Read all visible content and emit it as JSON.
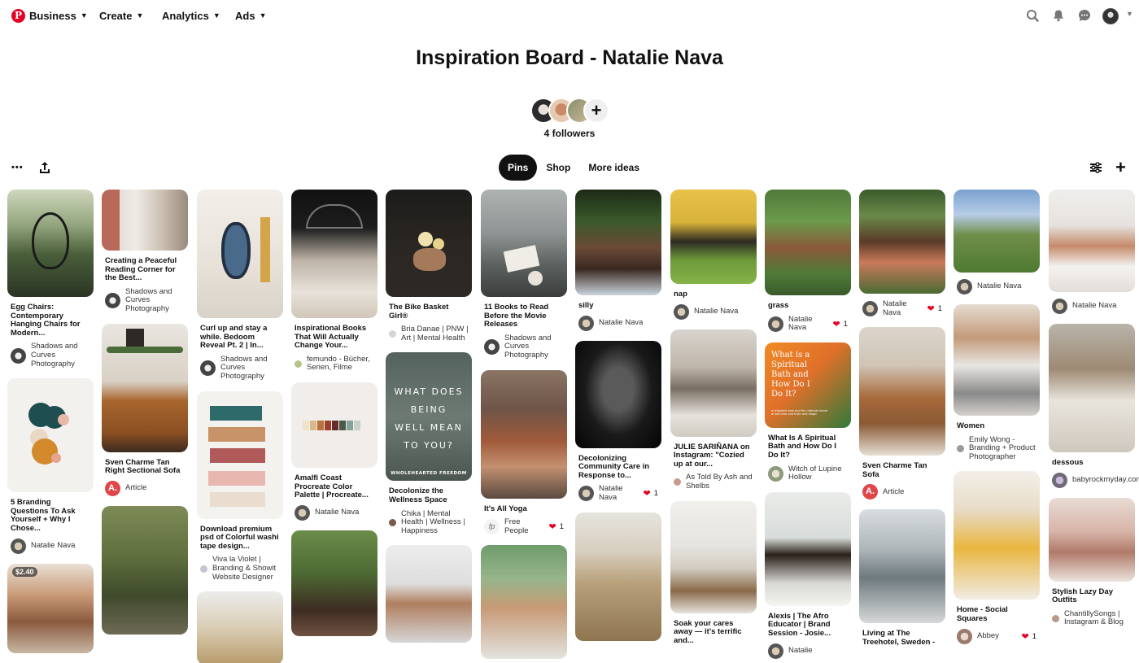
{
  "nav": {
    "logo": "P",
    "business": "Business",
    "create": "Create",
    "analytics": "Analytics",
    "ads": "Ads",
    "chevron": "⌄"
  },
  "icons": {
    "search": "search-icon",
    "bell": "bell-icon",
    "messages": "messages-icon",
    "avatar": "avatar",
    "chevron": "chevron-down-icon"
  },
  "board": {
    "title": "Inspiration Board - Natalie Nava",
    "followers": "4 followers",
    "add_collaborator": "+"
  },
  "toolbar": {
    "more": "•••",
    "share": "⇪",
    "filter": "⇋",
    "add": "+"
  },
  "tabs": [
    {
      "label": "Pins",
      "active": true
    },
    {
      "label": "Shop",
      "active": false
    },
    {
      "label": "More ideas",
      "active": false
    }
  ],
  "pins": {
    "c1": [
      {
        "title": "Egg Chairs: Contemporary Hanging Chairs for Modern...",
        "author": "Shadows and Curves Photography"
      },
      {
        "title": "5 Branding Questions To Ask Yourself + Why I Chose...",
        "author": "Natalie Nava"
      },
      {
        "price": "$2.40"
      }
    ],
    "c2": [
      {
        "title": "Creating a Peaceful Reading Corner for the Best...",
        "author": "Shadows and Curves Photography"
      },
      {
        "title": "Sven Charme Tan Right Sectional Sofa",
        "author": "Article",
        "author_initial": "A."
      },
      {}
    ],
    "c3": [
      {
        "title": "Curl up and stay a while. Bedoom Reveal Pt. 2 | In...",
        "author": "Shadows and Curves Photography"
      },
      {
        "title": "Download premium psd of Colorful washi tape design...",
        "author": "Viva la Violet | Branding & Showit Website Designer"
      },
      {}
    ],
    "c4": [
      {
        "title": "Inspirational Books That Will Actually Change Your...",
        "author": "femundo - Bücher, Serien, Filme"
      },
      {
        "title": "Amalfi Coast Procreate Color Palette | Procreate...",
        "author": "Natalie Nava"
      },
      {}
    ],
    "c5": [
      {
        "title": "The Bike Basket Girl®",
        "author": "Bria Danae | PNW | Art | Mental Health"
      },
      {
        "title": "Decolonize the Wellness Space",
        "author": "Chika | Mental Health | Wellness | Happiness",
        "overlay": "WHAT DOES BEING WELL MEAN TO YOU?",
        "overlay_footer": "WHOLEHEARTED FREEDOM"
      },
      {}
    ],
    "c6": [
      {
        "title": "11 Books to Read Before the Movie Releases",
        "author": "Shadows and Curves Photography"
      },
      {
        "title": "It's All Yoga",
        "author": "Free People",
        "reacts": "1"
      },
      {}
    ],
    "c7": [
      {
        "title": "silly",
        "author": "Natalie Nava"
      },
      {
        "title": "Decolonizing Community Care in Response to...",
        "author": "Natalie Nava",
        "reacts": "1"
      },
      {}
    ],
    "c8": [
      {
        "title": "nap",
        "author": "Natalie Nava"
      },
      {
        "title": "JULIE SARIÑANA on Instagram: \"Cozied up at our...",
        "author": "As Told By Ash and Shelbs"
      },
      {
        "title": "Soak your cares away — it's terrific and..."
      }
    ],
    "c9": [
      {
        "title": "grass",
        "author": "Natalie Nava",
        "reacts": "1"
      },
      {
        "title": "What Is A Spiritual Bath and How Do I Do It?",
        "author": "Witch of Lupine Hollow",
        "overlay": "What is a Spiritual Bath and How Do I Do It?",
        "overlay_sub": "a relaxable look and the ultimate blend of self-care and truth and magic"
      },
      {
        "title": "Alexis | The Afro Educator | Brand Session - Josie...",
        "author": "Natalie"
      }
    ],
    "c10": [
      {
        "title": "",
        "author": "Natalie Nava",
        "reacts": "1"
      },
      {
        "title": "Sven Charme Tan Sofa",
        "author": "Article",
        "author_initial": "A."
      },
      {
        "title": "Living at The Treehotel, Sweden -"
      }
    ],
    "c11": [
      {
        "title": "",
        "author": "Natalie Nava"
      },
      {
        "title": "Women",
        "author": "Emily Wong - Branding + Product Photographer"
      },
      {
        "title": "Home - Social Squares",
        "author": "Abbey",
        "reacts": "1"
      }
    ],
    "c12": [
      {
        "title": "",
        "author": "Natalie Nava"
      },
      {
        "title": "dessous",
        "author": "babyrockmyday.com"
      },
      {
        "title": "Stylish Lazy Day Outfits",
        "author": "ChantillySongs | Instagram & Blog"
      }
    ]
  }
}
